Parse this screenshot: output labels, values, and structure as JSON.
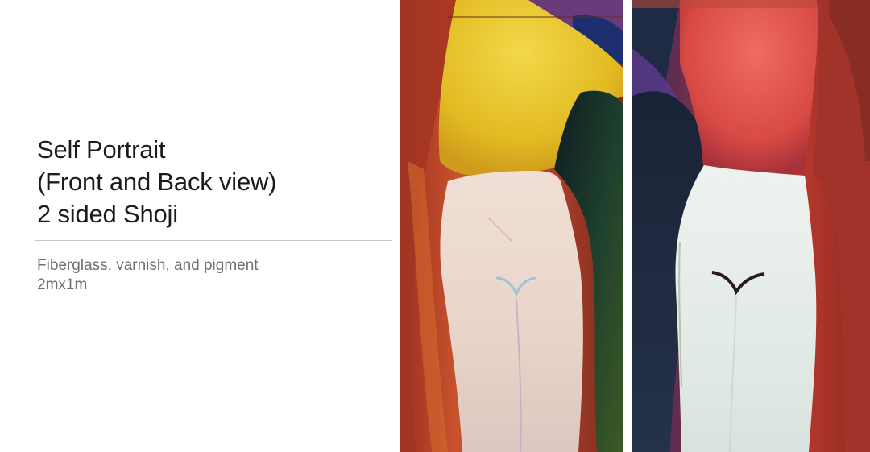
{
  "slide": {
    "title_lines": [
      "Self Portrait",
      "(Front and Back view)",
      "2 sided Shoji"
    ],
    "detail_lines": [
      "Fiberglass, varnish, and pigment",
      "2mx1m"
    ]
  },
  "artworks": [
    {
      "view": "front",
      "colors": {
        "background": "#b8452a",
        "torso": "#e6c52a",
        "figure": "#ecdcd2",
        "shadow": "#1f3a2a"
      }
    },
    {
      "view": "back",
      "colors": {
        "background": "#c23b2e",
        "torso": "#e0605a",
        "figure": "#e6ede9",
        "shadow": "#232a3d"
      }
    }
  ]
}
